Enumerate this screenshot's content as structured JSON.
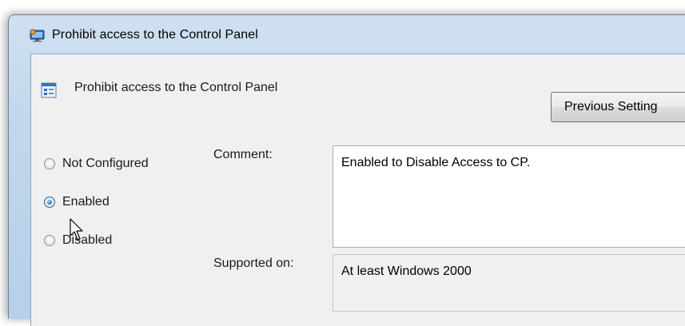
{
  "window": {
    "title": "Prohibit access to the Control Panel",
    "title_icon": "group-policy-icon"
  },
  "header": {
    "setting_title": "Prohibit access to the Control Panel",
    "setting_icon": "policy-setting-icon",
    "previous_label": "Previous Setting"
  },
  "state": {
    "options": [
      "Not Configured",
      "Enabled",
      "Disabled"
    ],
    "selected": "Enabled"
  },
  "comment": {
    "label": "Comment:",
    "value": "Enabled to Disable Access to CP."
  },
  "supported": {
    "label": "Supported on:",
    "value": "At least Windows 2000"
  },
  "colors": {
    "titlebar": "#c1d6ec",
    "client": "#f0f0f0",
    "radio_accent": "#2a8ad4"
  }
}
